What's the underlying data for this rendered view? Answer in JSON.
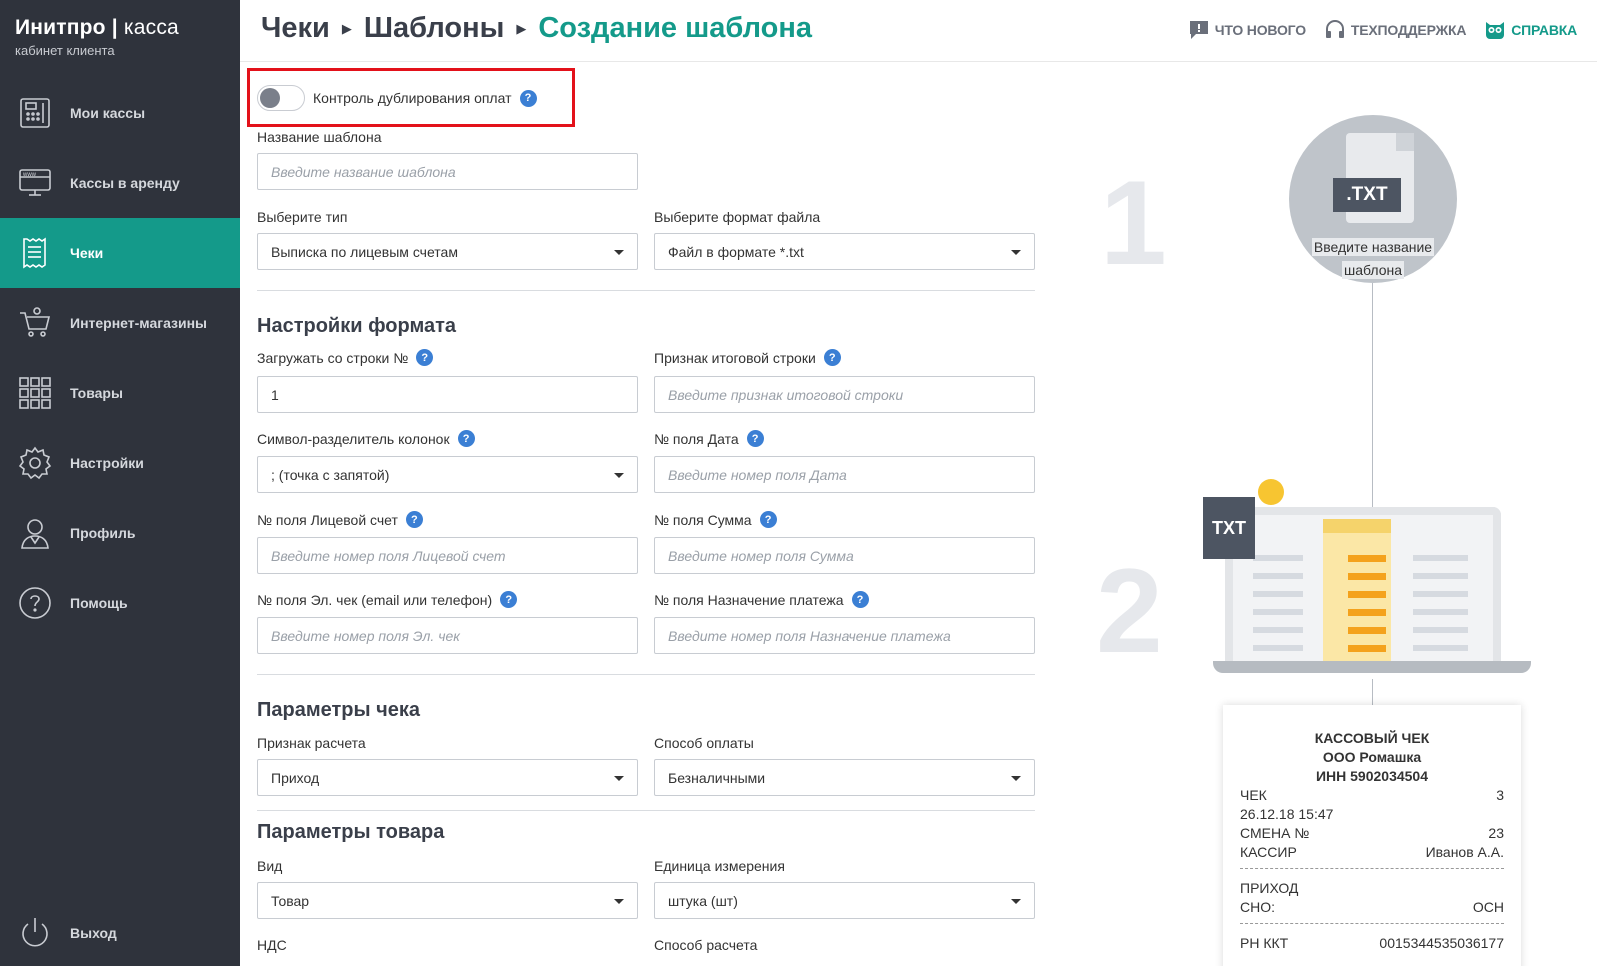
{
  "brand": {
    "name": "Инитпро",
    "divider": "|",
    "product": "касса",
    "subtitle": "кабинет клиента"
  },
  "sidebar": {
    "items": [
      {
        "label": "Мои кассы",
        "icon": "cash-register-icon",
        "active": false
      },
      {
        "label": "Кассы в аренду",
        "icon": "www-monitor-icon",
        "active": false
      },
      {
        "label": "Чеки",
        "icon": "receipt-icon",
        "active": true
      },
      {
        "label": "Интернет-магазины",
        "icon": "cart-icon",
        "active": false
      },
      {
        "label": "Товары",
        "icon": "grid-icon",
        "active": false
      },
      {
        "label": "Настройки",
        "icon": "gear-icon",
        "active": false
      },
      {
        "label": "Профиль",
        "icon": "user-icon",
        "active": false
      },
      {
        "label": "Помощь",
        "icon": "help-circle-icon",
        "active": false
      }
    ],
    "logout": "Выход"
  },
  "header": {
    "breadcrumb": [
      "Чеки",
      "Шаблоны"
    ],
    "current": "Создание шаблона",
    "links": {
      "whats_new": "ЧТО НОВОГО",
      "support": "ТЕХПОДДЕРЖКА",
      "help": "СПРАВКА"
    }
  },
  "form": {
    "toggle_label": "Контроль дублирования оплат",
    "template_name": {
      "label": "Название шаблона",
      "placeholder": "Введите название шаблона"
    },
    "type": {
      "label": "Выберите тип",
      "value": "Выписка по лицевым счетам"
    },
    "file_format": {
      "label": "Выберите формат файла",
      "value": "Файл в формате *.txt"
    },
    "format_settings_title": "Настройки формата",
    "start_row": {
      "label": "Загружать со строки №",
      "value": "1"
    },
    "total_row": {
      "label": "Признак итоговой строки",
      "placeholder": "Введите признак итоговой строки"
    },
    "separator": {
      "label": "Символ-разделитель колонок",
      "value": "; (точка с запятой)"
    },
    "date_field": {
      "label": "№ поля Дата",
      "placeholder": "Введите номер поля Дата"
    },
    "account_field": {
      "label": "№ поля Лицевой счет",
      "placeholder": "Введите номер поля Лицевой счет"
    },
    "sum_field": {
      "label": "№ поля Сумма",
      "placeholder": "Введите номер поля Сумма"
    },
    "email_field": {
      "label": "№ поля Эл. чек (email или телефон)",
      "placeholder": "Введите номер поля Эл. чек"
    },
    "purpose_field": {
      "label": "№ поля Назначение платежа",
      "placeholder": "Введите номер поля Назначение платежа"
    },
    "receipt_params_title": "Параметры чека",
    "calc_sign": {
      "label": "Признак расчета",
      "value": "Приход"
    },
    "payment_method": {
      "label": "Способ оплаты",
      "value": "Безналичными"
    },
    "goods_params_title": "Параметры товара",
    "kind": {
      "label": "Вид",
      "value": "Товар"
    },
    "unit": {
      "label": "Единица измерения",
      "value": "штука (шт)"
    },
    "vat": {
      "label": "НДС"
    },
    "calc_method": {
      "label": "Способ расчета"
    }
  },
  "illustration": {
    "step1": "1",
    "step2": "2",
    "doc_badge": ".TXT",
    "circle_text_line1": "Введите название",
    "circle_text_line2": "шаблона",
    "laptop_badge": "TXT",
    "receipt": {
      "title": "КАССОВЫЙ ЧЕК",
      "org": "ООО Ромашка",
      "inn": "ИНН 5902034504",
      "check_label": "ЧЕК",
      "check_value": "3",
      "datetime": "26.12.18 15:47",
      "shift_label": "СМЕНА №",
      "shift_value": "23",
      "cashier_label": "КАССИР",
      "cashier_value": "Иванов А.А.",
      "type": "ПРИХОД",
      "sno_label": "СНО:",
      "sno_value": "ОСН",
      "rn_label": "РН ККТ",
      "rn_value": "0015344535036177"
    }
  },
  "colors": {
    "accent": "#149a8a",
    "sidebar": "#2f333c",
    "highlight": "#e3111a",
    "help_badge": "#3b7fd4"
  }
}
